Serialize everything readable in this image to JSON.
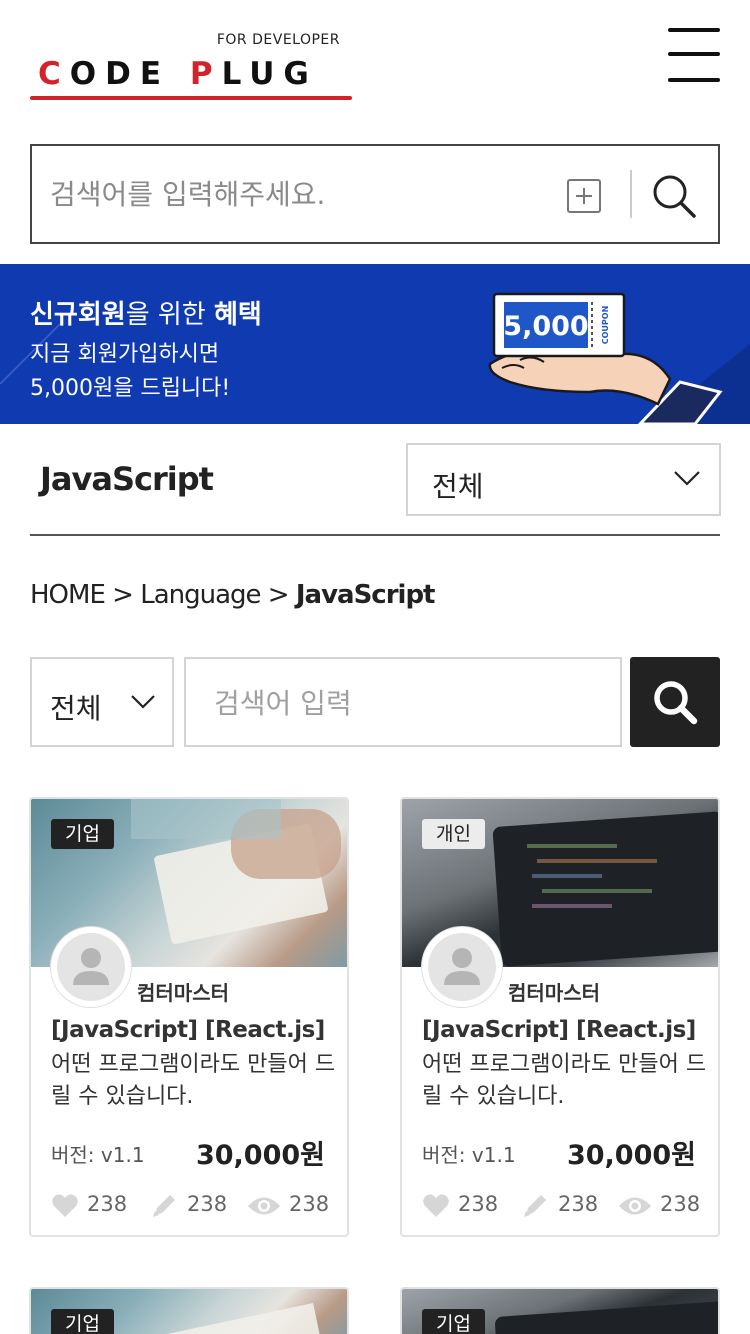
{
  "header": {
    "logo_sub": "FOR DEVELOPER",
    "logo_main_a": "C",
    "logo_main_b": "ODE ",
    "logo_main_c": "P",
    "logo_main_d": "LUG"
  },
  "search": {
    "placeholder": "검색어를 입력해주세요."
  },
  "banner": {
    "line1_bold_a": "신규회원",
    "line1_normal": "을 위한 ",
    "line1_bold_b": "혜택",
    "line2": "지금 회원가입하시면",
    "line3": "5,000원을 드립니다!",
    "coupon_value": "5,000",
    "coupon_label": "COUPON"
  },
  "category": {
    "title": "JavaScript",
    "select_value": "전체"
  },
  "breadcrumb": {
    "home": "HOME",
    "sep1": " > ",
    "level1": "Language",
    "sep2": " > ",
    "current": "JavaScript"
  },
  "filter": {
    "select_value": "전체",
    "placeholder": "검색어 입력"
  },
  "cards": [
    {
      "badge": "기업",
      "seller": "컴터마스터",
      "title": "[JavaScript] [React.js]",
      "desc": "어떤 프로그램이라도 만들어 드릴 수 있습니다.",
      "version": "버전: v1.1",
      "price": "30,000원",
      "likes": "238",
      "edits": "238",
      "views": "238"
    },
    {
      "badge": "개인",
      "seller": "컴터마스터",
      "title": "[JavaScript] [React.js]",
      "desc": "어떤 프로그램이라도 만들어 드릴 수 있습니다.",
      "version": "버전: v1.1",
      "price": "30,000원",
      "likes": "238",
      "edits": "238",
      "views": "238"
    },
    {
      "badge": "기업"
    },
    {
      "badge": "기업"
    }
  ],
  "colors": {
    "brand_red": "#d3232a",
    "banner_blue": "#0f3ab0",
    "dark": "#222222"
  }
}
